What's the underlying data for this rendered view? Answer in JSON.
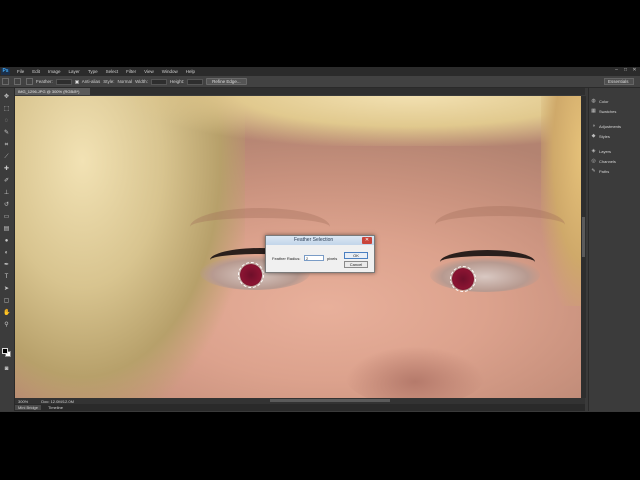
{
  "menubar": {
    "logo": "Ps",
    "items": [
      "File",
      "Edit",
      "Image",
      "Layer",
      "Type",
      "Select",
      "Filter",
      "View",
      "Window",
      "Help"
    ],
    "window_controls": [
      "–",
      "□",
      "✕"
    ]
  },
  "options_bar": {
    "feather_label": "Feather:",
    "feather_value": "",
    "anti_alias_label": "Anti-alias",
    "style_label": "Style:",
    "style_value": "Normal",
    "width_label": "Width:",
    "height_label": "Height:",
    "refine_edge_label": "Refine Edge...",
    "workspace_label": "Essentials"
  },
  "document": {
    "tab_title": "IMG_1296.JPG @ 300% (RGB/8*)",
    "zoom": "300%",
    "doc_info": "Doc: 12.0M/12.0M"
  },
  "dialog": {
    "title": "Feather Selection",
    "radius_label": "Feather Radius:",
    "radius_value": "2",
    "units": "pixels",
    "ok_label": "OK",
    "cancel_label": "Cancel",
    "close_glyph": "✕"
  },
  "bottom_tabs": [
    "Mini Bridge",
    "Timeline"
  ],
  "panels": [
    {
      "icon": "palette-icon",
      "label": "Color"
    },
    {
      "icon": "swatches-icon",
      "label": "Swatches"
    },
    {
      "icon": "adjustments-icon",
      "label": "Adjustments"
    },
    {
      "icon": "styles-icon",
      "label": "Styles"
    },
    {
      "icon": "layers-icon",
      "label": "Layers"
    },
    {
      "icon": "channels-icon",
      "label": "Channels"
    },
    {
      "icon": "paths-icon",
      "label": "Paths"
    }
  ],
  "tools": [
    "move",
    "marquee",
    "lasso",
    "quick-select",
    "crop",
    "eyedropper",
    "healing",
    "brush",
    "clone-stamp",
    "history-brush",
    "eraser",
    "gradient",
    "blur",
    "dodge",
    "pen",
    "type",
    "path-select",
    "shape",
    "hand",
    "zoom"
  ],
  "colors": {
    "app_bg": "#3a3a3a",
    "dialog_title_text": "#2b3d55",
    "close_button": "#c9443a",
    "red_eye": "#8a1432"
  }
}
